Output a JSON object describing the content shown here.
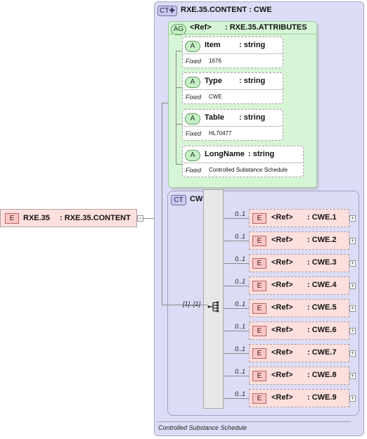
{
  "root": {
    "badge": "E",
    "name": "RXE.35",
    "type": ": RXE.35.CONTENT"
  },
  "content_type": {
    "badge": "CT",
    "title": "RXE.35.CONTENT : CWE",
    "documentation": "Controlled Substance Schedule"
  },
  "attribute_group": {
    "badge": "AG",
    "ref": "<Ref>",
    "type": ": RXE.35.ATTRIBUTES",
    "attributes": [
      {
        "badge": "A",
        "name": "Item",
        "type": ": string",
        "fixed_label": "Fixed",
        "fixed_value": "1676"
      },
      {
        "badge": "A",
        "name": "Type",
        "type": ": string",
        "fixed_label": "Fixed",
        "fixed_value": "CWE"
      },
      {
        "badge": "A",
        "name": "Table",
        "type": ": string",
        "fixed_label": "Fixed",
        "fixed_value": "HL70477"
      },
      {
        "badge": "A",
        "name": "LongName",
        "type": ": string",
        "fixed_label": "Fixed",
        "fixed_value": "Controlled Substance Schedule"
      }
    ]
  },
  "cwe_type": {
    "badge": "CT",
    "title": "CWE",
    "sequence_occurrence": "[1]..[1]",
    "elements": [
      {
        "occurrence": "0..1",
        "badge": "E",
        "ref": "<Ref>",
        "type": ": CWE.1"
      },
      {
        "occurrence": "0..1",
        "badge": "E",
        "ref": "<Ref>",
        "type": ": CWE.2"
      },
      {
        "occurrence": "0..1",
        "badge": "E",
        "ref": "<Ref>",
        "type": ": CWE.3"
      },
      {
        "occurrence": "0..1",
        "badge": "E",
        "ref": "<Ref>",
        "type": ": CWE.4"
      },
      {
        "occurrence": "0..1",
        "badge": "E",
        "ref": "<Ref>",
        "type": ": CWE.5"
      },
      {
        "occurrence": "0..1",
        "badge": "E",
        "ref": "<Ref>",
        "type": ": CWE.6"
      },
      {
        "occurrence": "0..1",
        "badge": "E",
        "ref": "<Ref>",
        "type": ": CWE.7"
      },
      {
        "occurrence": "0..1",
        "badge": "E",
        "ref": "<Ref>",
        "type": ": CWE.8"
      },
      {
        "occurrence": "0..1",
        "badge": "E",
        "ref": "<Ref>",
        "type": ": CWE.9"
      }
    ]
  }
}
